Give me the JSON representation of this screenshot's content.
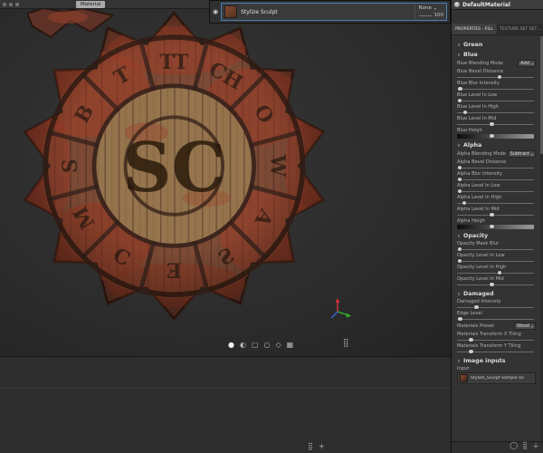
{
  "icons": {
    "section_chevron": "∨",
    "dropdown_arrow": "▾",
    "eye": "◉"
  },
  "viewport": {
    "top_toolbar": {
      "material_label": "Material"
    },
    "medallion": {
      "ring_letters": [
        "TT",
        "CH",
        "O",
        "W",
        "A",
        "Ƨ",
        "E",
        "Ɔ",
        "M",
        "S",
        "B",
        "T"
      ],
      "monogram": "SC"
    },
    "display_toolbar": [
      {
        "name": "material-sphere-icon",
        "glyph": "●"
      },
      {
        "name": "half-sphere-icon",
        "glyph": "◐"
      },
      {
        "name": "wireframe-square-icon",
        "glyph": "▢"
      },
      {
        "name": "circle-icon",
        "glyph": "○"
      },
      {
        "name": "brush-icon",
        "glyph": "◇"
      },
      {
        "name": "texture-view-icon",
        "glyph": "▦"
      }
    ],
    "shelf_grid_icon": {
      "name": "shelf-grid-icon",
      "glyph": "⣿"
    }
  },
  "layers_panel": {
    "layer": {
      "name": "Stylize Sculpt",
      "blend": "None",
      "opacity": "100"
    }
  },
  "right_panel": {
    "header_title": "DefaultMaterial",
    "tabs": [
      {
        "label": "PROPERTIES - FILL"
      },
      {
        "label": "TEXTURE SET SET…"
      }
    ],
    "rows": [
      {
        "type": "section",
        "label": "Green"
      },
      {
        "type": "section",
        "label": "Blue"
      },
      {
        "type": "dropdown",
        "label": "Blue Blending Mode",
        "value": "Add"
      },
      {
        "type": "slider",
        "label": "Blue Bevel Distance",
        "value": 55
      },
      {
        "type": "slider",
        "label": "Blue Blur Intensity",
        "value": 4
      },
      {
        "type": "slider",
        "label": "Blue Level In Low",
        "value": 3
      },
      {
        "type": "slider",
        "label": "Blue Level In High",
        "value": 10
      },
      {
        "type": "slider",
        "label": "Blue Level In Mid",
        "value": 45
      },
      {
        "type": "slider",
        "label": "Blue Heigh",
        "value": 45,
        "dark": true
      },
      {
        "type": "section",
        "label": "Alpha"
      },
      {
        "type": "dropdown",
        "label": "Alpha Blending Mode",
        "value": "Subtract"
      },
      {
        "type": "slider",
        "label": "Alpha Bevel Distance",
        "value": 3
      },
      {
        "type": "slider",
        "label": "Alpha Blur intensity",
        "value": 3
      },
      {
        "type": "slider",
        "label": "Alpha Level In Low",
        "value": 3
      },
      {
        "type": "slider",
        "label": "Alpha Level In High",
        "value": 9
      },
      {
        "type": "slider",
        "label": "Alpha Level In Mid",
        "value": 45
      },
      {
        "type": "slider",
        "label": "Alpha Heigh",
        "value": 45,
        "dark": true
      },
      {
        "type": "section",
        "label": "Opacity"
      },
      {
        "type": "slider",
        "label": "Opacity Mask Blur",
        "value": 3
      },
      {
        "type": "slider",
        "label": "Opacity Level In Low",
        "value": 3
      },
      {
        "type": "slider",
        "label": "Opacity Level In High",
        "value": 55
      },
      {
        "type": "slider",
        "label": "Opacity Level In Mid",
        "value": 45
      },
      {
        "type": "section",
        "label": "Damaged"
      },
      {
        "type": "slider",
        "label": "Damaged Intensity",
        "value": 25
      },
      {
        "type": "slider",
        "label": "Edge Level",
        "value": 4
      },
      {
        "type": "dropdown",
        "label": "Materials Preset",
        "value": "Wood"
      },
      {
        "type": "slider",
        "label": "Materials Transform X Tiling",
        "value": 18
      },
      {
        "type": "slider",
        "label": "Materials Transform Y Tiling",
        "value": 18
      },
      {
        "type": "section",
        "label": "Image inputs"
      },
      {
        "type": "image",
        "label": "Input",
        "value": "Stylize_Sculpt Sample 02"
      }
    ]
  },
  "bottom_bar": {
    "left_icons": [
      {
        "name": "grid-icon",
        "glyph": "⣿"
      },
      {
        "name": "add-button",
        "glyph": "+"
      }
    ],
    "right_icons": [
      {
        "name": "picker-circle-icon",
        "glyph": "◯"
      },
      {
        "name": "grid-icon",
        "glyph": "⣿"
      },
      {
        "name": "plus-button",
        "glyph": "＋"
      }
    ]
  }
}
